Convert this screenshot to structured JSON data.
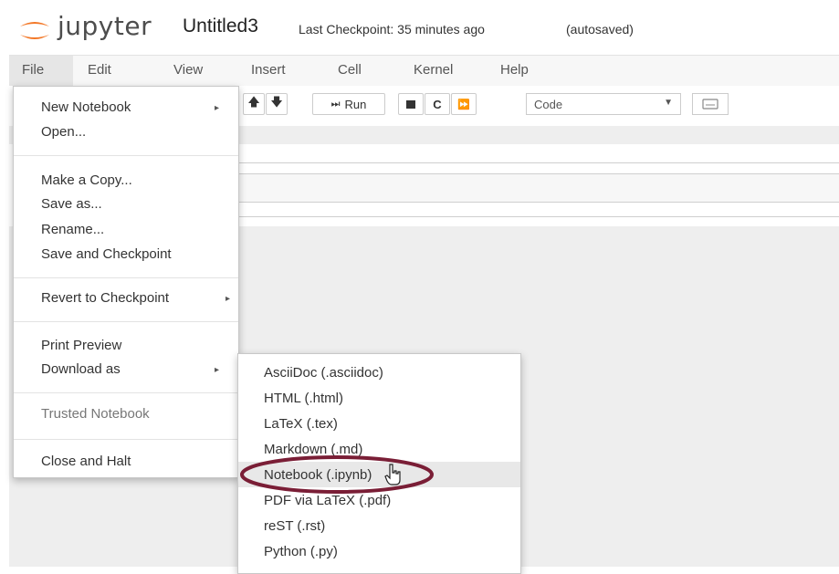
{
  "header": {
    "logo_text": "jupyter",
    "notebook_title": "Untitled3",
    "checkpoint_text": "Last Checkpoint: 35 minutes ago",
    "autosave_status": "(autosaved)"
  },
  "menubar": {
    "items": [
      "File",
      "Edit",
      "View",
      "Insert",
      "Cell",
      "Kernel",
      "Help"
    ]
  },
  "toolbar": {
    "run_label": "Run",
    "cell_type": "Code"
  },
  "file_menu": {
    "new_notebook": "New Notebook",
    "open": "Open...",
    "make_copy": "Make a Copy...",
    "save_as": "Save as...",
    "rename": "Rename...",
    "save_checkpoint": "Save and Checkpoint",
    "revert": "Revert to Checkpoint",
    "print_preview": "Print Preview",
    "download_as": "Download as",
    "trusted": "Trusted Notebook",
    "close_halt": "Close and Halt"
  },
  "download_menu": {
    "items": [
      "AsciiDoc (.asciidoc)",
      "HTML (.html)",
      "LaTeX (.tex)",
      "Markdown (.md)",
      "Notebook (.ipynb)",
      "PDF via LaTeX (.pdf)",
      "reST (.rst)",
      "Python (.py)"
    ],
    "highlighted_index": 4
  },
  "colors": {
    "logo_orange": "#F37726",
    "annotation_oval": "#7a1e36",
    "menu_bg": "#f7f7f7",
    "notebook_bg": "#eeeeee"
  }
}
